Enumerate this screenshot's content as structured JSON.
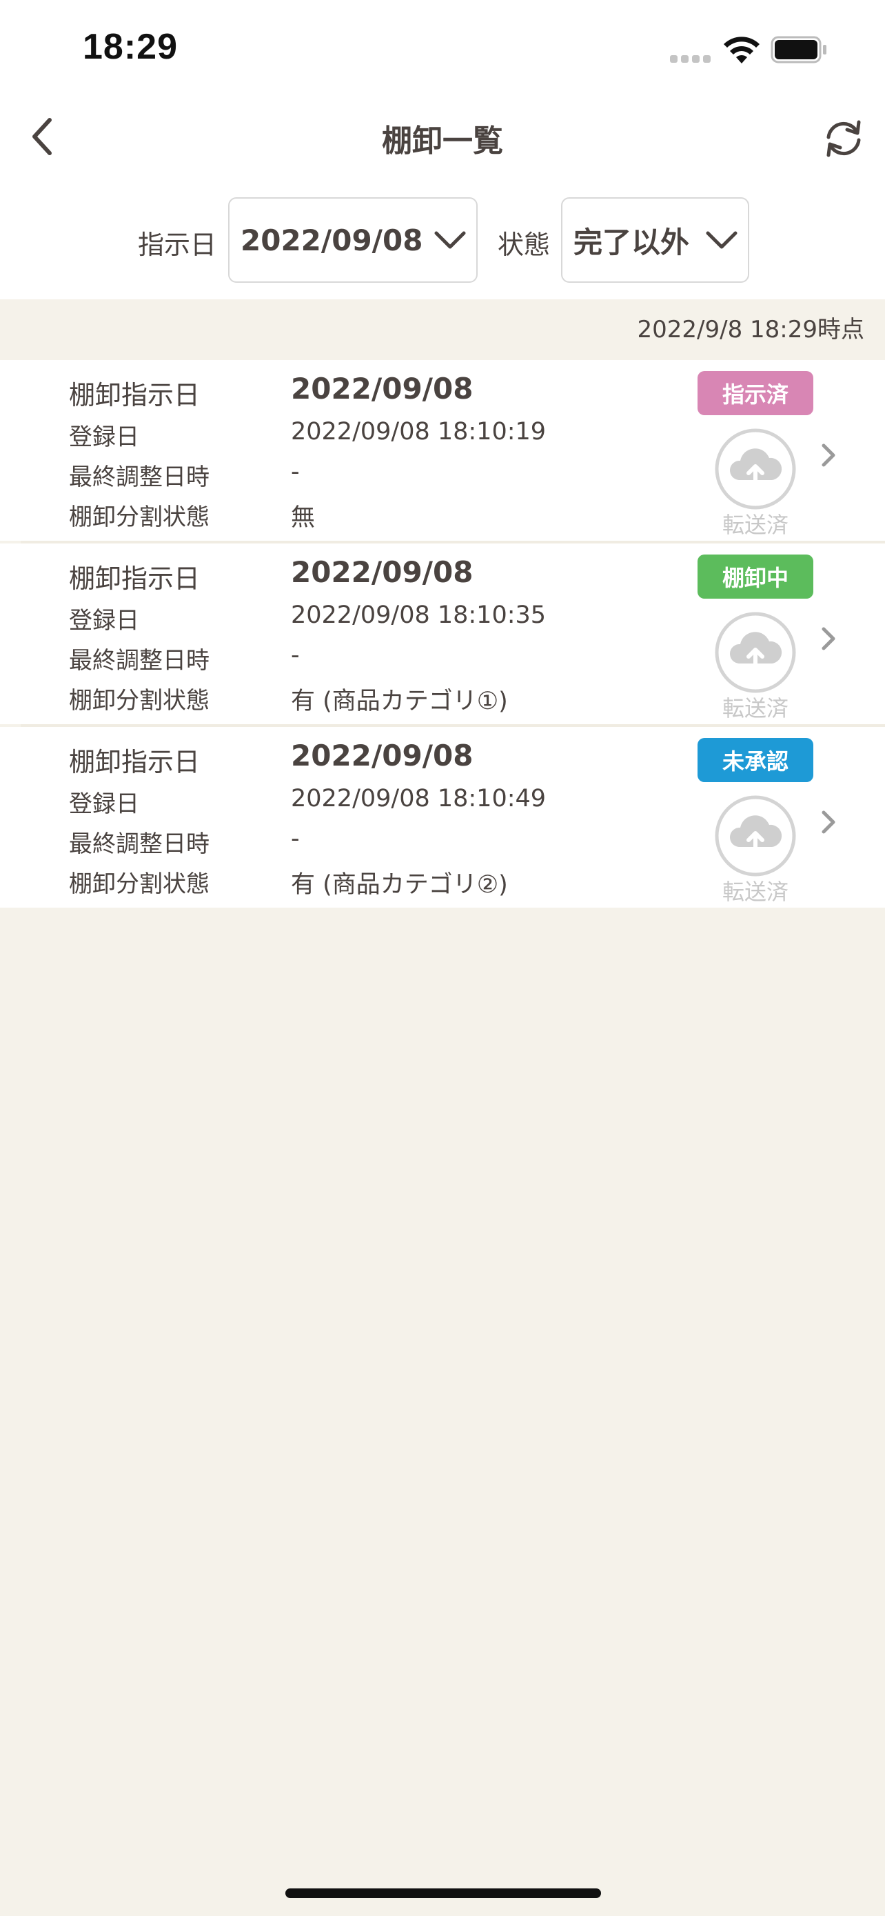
{
  "status_bar": {
    "time": "18:29"
  },
  "nav": {
    "title": "棚卸一覧"
  },
  "filters": {
    "date_label": "指示日",
    "date_value": "2022/09/08",
    "status_label": "状態",
    "status_value": "完了以外"
  },
  "timestamp": "2022/9/8 18:29時点",
  "labels": {
    "instruction_date": "棚卸指示日",
    "registered": "登録日",
    "last_adjusted": "最終調整日時",
    "split_status": "棚卸分割状態",
    "transferred": "転送済"
  },
  "items": [
    {
      "instruction_date": "2022/09/08",
      "registered": "2022/09/08 18:10:19",
      "last_adjusted": "-",
      "split_status": "無",
      "badge": "指示済",
      "badge_color": "#d886b4"
    },
    {
      "instruction_date": "2022/09/08",
      "registered": "2022/09/08 18:10:35",
      "last_adjusted": "-",
      "split_status": "有 (商品カテゴリ①)",
      "badge": "棚卸中",
      "badge_color": "#5cbc5c"
    },
    {
      "instruction_date": "2022/09/08",
      "registered": "2022/09/08 18:10:49",
      "last_adjusted": "-",
      "split_status": "有 (商品カテゴリ②)",
      "badge": "未承認",
      "badge_color": "#1e9ad6"
    }
  ],
  "icons": {
    "back": "chevron-left-icon",
    "refresh": "refresh-icon",
    "dropdown": "chevron-down-icon",
    "upload": "cloud-upload-icon",
    "row": "chevron-right-icon"
  }
}
